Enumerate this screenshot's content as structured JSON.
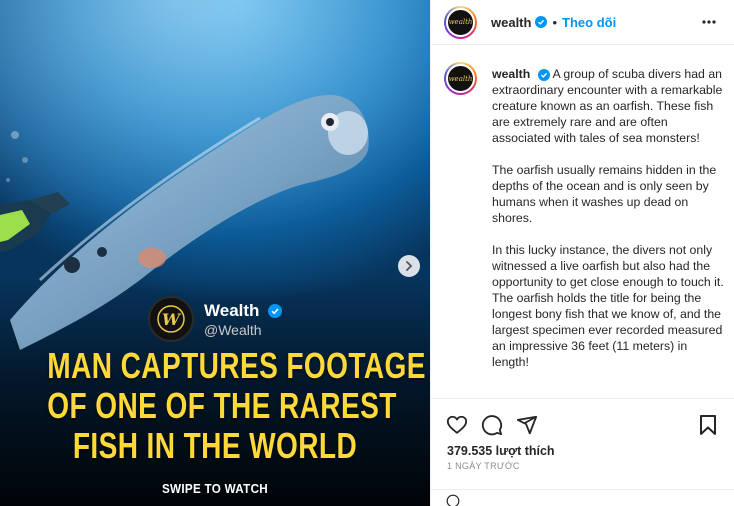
{
  "post": {
    "media": {
      "brand_name": "Wealth",
      "brand_handle": "@Wealth",
      "logo_text": "W",
      "headline": [
        "MAN CAPTURES FOOTAGE",
        "OF ONE OF THE RAREST",
        "FISH IN THE WORLD"
      ],
      "cta": "SWIPE TO WATCH"
    },
    "header": {
      "username": "wealth",
      "avatar_text": "wealth",
      "follow_label": "Theo dõi"
    },
    "caption": {
      "username": "wealth",
      "paragraphs": [
        "A group of scuba divers had an extraordinary encounter with a remarkable creature known as an oarfish. These fish are extremely rare and are often associated with tales of sea monsters!",
        "The oarfish usually remains hidden in the depths of the ocean and is only seen by humans when it washes up dead on shores.",
        "In this lucky instance, the divers not only witnessed a live oarfish but also had the opportunity to get close enough to touch it. The oarfish holds the title for being the longest bony fish that we know of, and the largest specimen ever recorded measured an impressive 36 feet (11 meters) in length!"
      ]
    },
    "stats": {
      "likes": "379.535 lượt thích",
      "time": "1 NGÀY TRƯỚC"
    },
    "colors": {
      "accent": "#0095f6",
      "headline": "#ffd93a",
      "verified": "#0095f6"
    },
    "icons": [
      "chevron-right-icon",
      "verified-icon",
      "more-icon",
      "heart-icon",
      "comment-icon",
      "share-icon",
      "bookmark-icon",
      "emoji-icon"
    ]
  }
}
